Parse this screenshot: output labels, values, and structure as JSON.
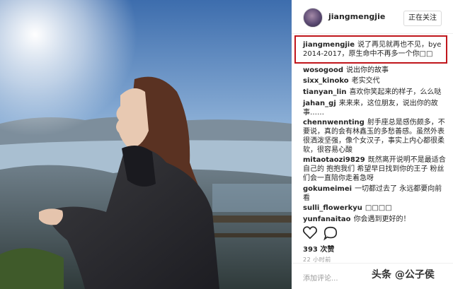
{
  "header": {
    "username": "jiangmengjie",
    "follow_label": "正在关注"
  },
  "comments": [
    {
      "user": "jiangmengjie",
      "text": "说了再见就再也不见，bye 2014-2017，原生命中不再多一个你□□"
    },
    {
      "user": "wosogood",
      "text": "说出你的故事"
    },
    {
      "user": "sixx_kinoko",
      "text": "老实交代"
    },
    {
      "user": "tianyan_lin",
      "text": "喜欢你笑起来的样子，么么哒"
    },
    {
      "user": "jahan_gj",
      "text": "来来来，这位朋友，说出你的故事……"
    },
    {
      "user": "chennwennting",
      "text": "射手座总是感伤颇多，不要说，真的会有林鑫玉的多愁善感。虽然外表很洒泼坚强，像个女汉子，事实上内心都很柔软，很容易心酸"
    },
    {
      "user": "mitaotaozi9829",
      "text": "既然离开说明不是最适合自己的 抱抱我们 希望早日找到你的王子 粉丝们会一直陪你走着急呀"
    },
    {
      "user": "gokumeimei",
      "text": "一切都过去了 永远都要向前看"
    },
    {
      "user": "sulli_flowerkyu",
      "text": "□□□□"
    },
    {
      "user": "yunfanaitao",
      "text": "你会遇到更好的！"
    }
  ],
  "actions": {
    "likes": "393 次赞",
    "time": "22 小时前",
    "add_comment_placeholder": "添加评论..."
  },
  "watermark": "头条 @公子侯",
  "colors": {
    "highlight": "#c0161c",
    "text": "#262626",
    "muted": "#999999"
  },
  "icons": [
    "heart-icon",
    "comment-icon"
  ]
}
